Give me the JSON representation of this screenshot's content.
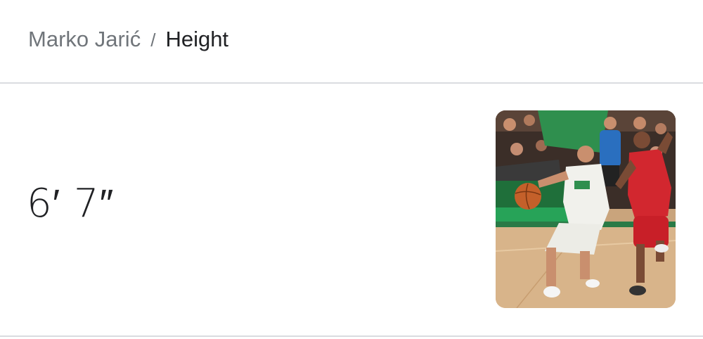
{
  "breadcrumb": {
    "entity": "Marko Jarić",
    "separator": "/",
    "attribute": "Height"
  },
  "answer": {
    "value": "6′ 7″"
  },
  "thumbnail": {
    "subject": "basketball-player-photo"
  },
  "colors": {
    "breadcrumb_link": "#70757a",
    "text_primary": "#202124",
    "divider": "#dadce0"
  }
}
